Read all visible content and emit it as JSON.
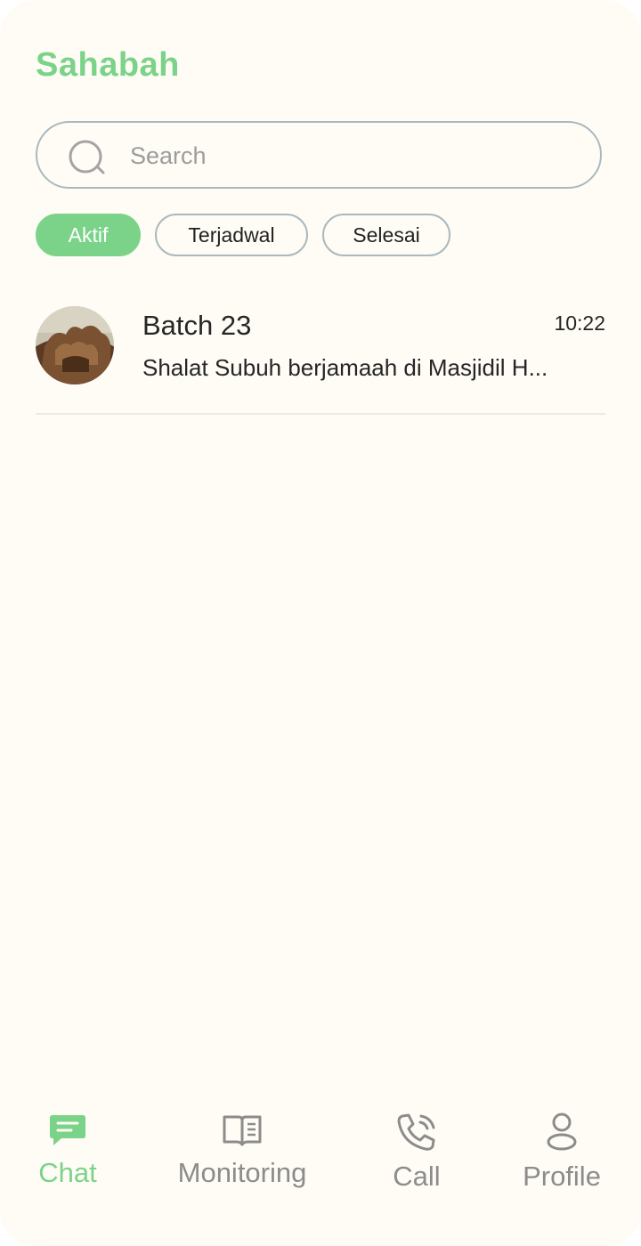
{
  "app": {
    "title": "Sahabah"
  },
  "search": {
    "placeholder": "Search"
  },
  "filters": [
    {
      "label": "Aktif",
      "active": true
    },
    {
      "label": "Terjadwal",
      "active": false
    },
    {
      "label": "Selesai",
      "active": false
    }
  ],
  "chats": [
    {
      "name": "Batch 23",
      "time": "10:22",
      "preview": "Shalat Subuh berjamaah di Masjidil H..."
    }
  ],
  "nav": [
    {
      "label": "Chat",
      "icon": "chat-icon",
      "active": true
    },
    {
      "label": "Monitoring",
      "icon": "book-icon",
      "active": false
    },
    {
      "label": "Call",
      "icon": "phone-icon",
      "active": false
    },
    {
      "label": "Profile",
      "icon": "user-icon",
      "active": false
    }
  ],
  "colors": {
    "accent": "#7bd389",
    "background": "#fefcf5",
    "border": "#aab9bf",
    "inactive": "#8c8c8c"
  }
}
